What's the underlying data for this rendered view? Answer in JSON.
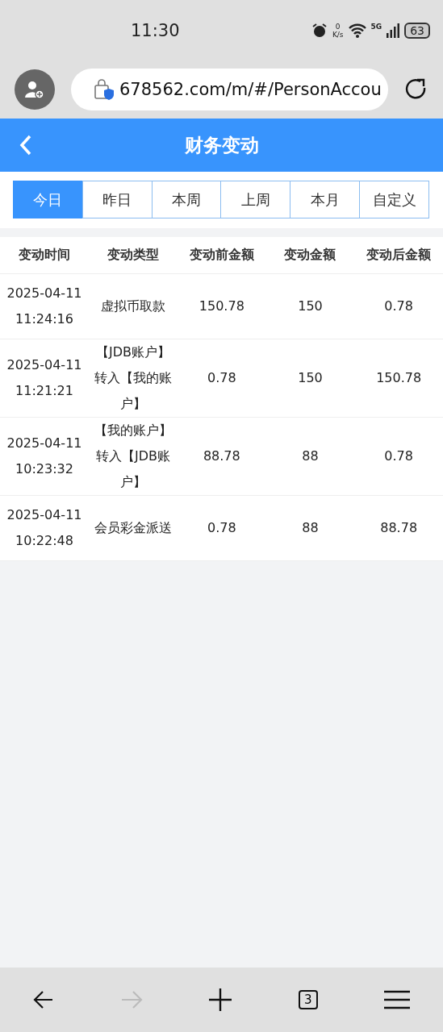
{
  "status_bar": {
    "time": "11:30",
    "net_speed": "0",
    "net_unit": "K/s",
    "network": "5G",
    "battery": "63"
  },
  "browser": {
    "url": "678562.com/m/#/PersonAccou"
  },
  "header": {
    "title": "财务变动"
  },
  "tabs": [
    {
      "label": "今日",
      "selected": true
    },
    {
      "label": "昨日",
      "selected": false
    },
    {
      "label": "本周",
      "selected": false
    },
    {
      "label": "上周",
      "selected": false
    },
    {
      "label": "本月",
      "selected": false
    },
    {
      "label": "自定义",
      "selected": false
    }
  ],
  "table": {
    "columns": [
      "变动时间",
      "变动类型",
      "变动前金额",
      "变动金额",
      "变动后金额"
    ],
    "rows": [
      {
        "date": "2025-04-11",
        "time": "11:24:16",
        "type": "虚拟币取款",
        "before": "150.78",
        "amount": "150",
        "after": "0.78"
      },
      {
        "date": "2025-04-11",
        "time": "11:21:21",
        "type": "【JDB账户】转入【我的账户】",
        "before": "0.78",
        "amount": "150",
        "after": "150.78"
      },
      {
        "date": "2025-04-11",
        "time": "10:23:32",
        "type": "【我的账户】转入【JDB账户】",
        "before": "88.78",
        "amount": "88",
        "after": "0.78"
      },
      {
        "date": "2025-04-11",
        "time": "10:22:48",
        "type": "会员彩金派送",
        "before": "0.78",
        "amount": "88",
        "after": "88.78"
      }
    ]
  },
  "bottom_nav": {
    "forward_disabled": true,
    "tab_count": "3"
  }
}
